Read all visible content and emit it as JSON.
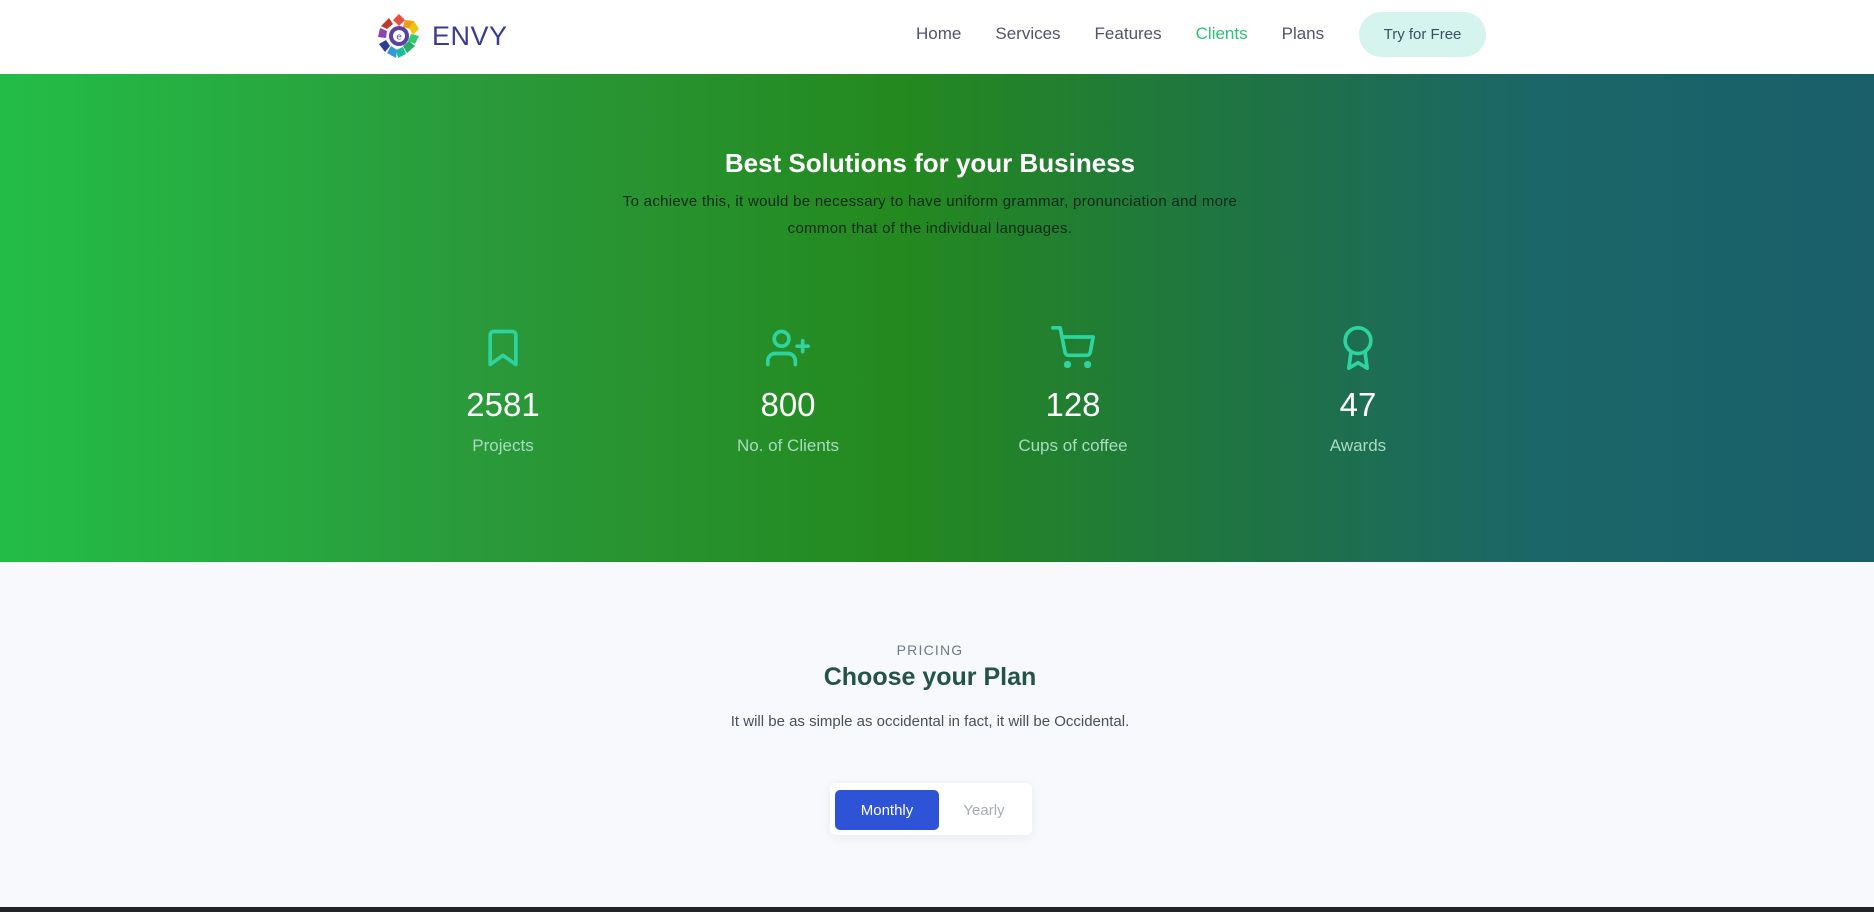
{
  "brand": {
    "name": "ENVY",
    "logo_icon": "colorful-flower-logo"
  },
  "nav": {
    "links": [
      {
        "label": "Home",
        "active": false
      },
      {
        "label": "Services",
        "active": false
      },
      {
        "label": "Features",
        "active": false
      },
      {
        "label": "Clients",
        "active": true
      },
      {
        "label": "Plans",
        "active": false
      }
    ],
    "cta_label": "Try for Free",
    "active_color": "#2bc475"
  },
  "hero": {
    "title": "Best Solutions for your Business",
    "subtitle": "To achieve this, it would be necessary to have uniform grammar, pronunciation and more common that of the individual languages.",
    "stats": [
      {
        "icon": "bookmark-icon",
        "value": "2581",
        "label": "Projects"
      },
      {
        "icon": "user-plus-icon",
        "value": "800",
        "label": "No. of Clients"
      },
      {
        "icon": "shopping-cart-icon",
        "value": "128",
        "label": "Cups of coffee"
      },
      {
        "icon": "award-icon",
        "value": "47",
        "label": "Awards"
      }
    ],
    "icon_color": "#2fd3a0"
  },
  "pricing": {
    "eyebrow": "PRICING",
    "title": "Choose your Plan",
    "subtitle": "It will be as simple as occidental in fact, it will be Occidental.",
    "toggle": {
      "monthly": "Monthly",
      "yearly": "Yearly",
      "selected": "Monthly"
    },
    "accent_color": "#2f53d6"
  }
}
